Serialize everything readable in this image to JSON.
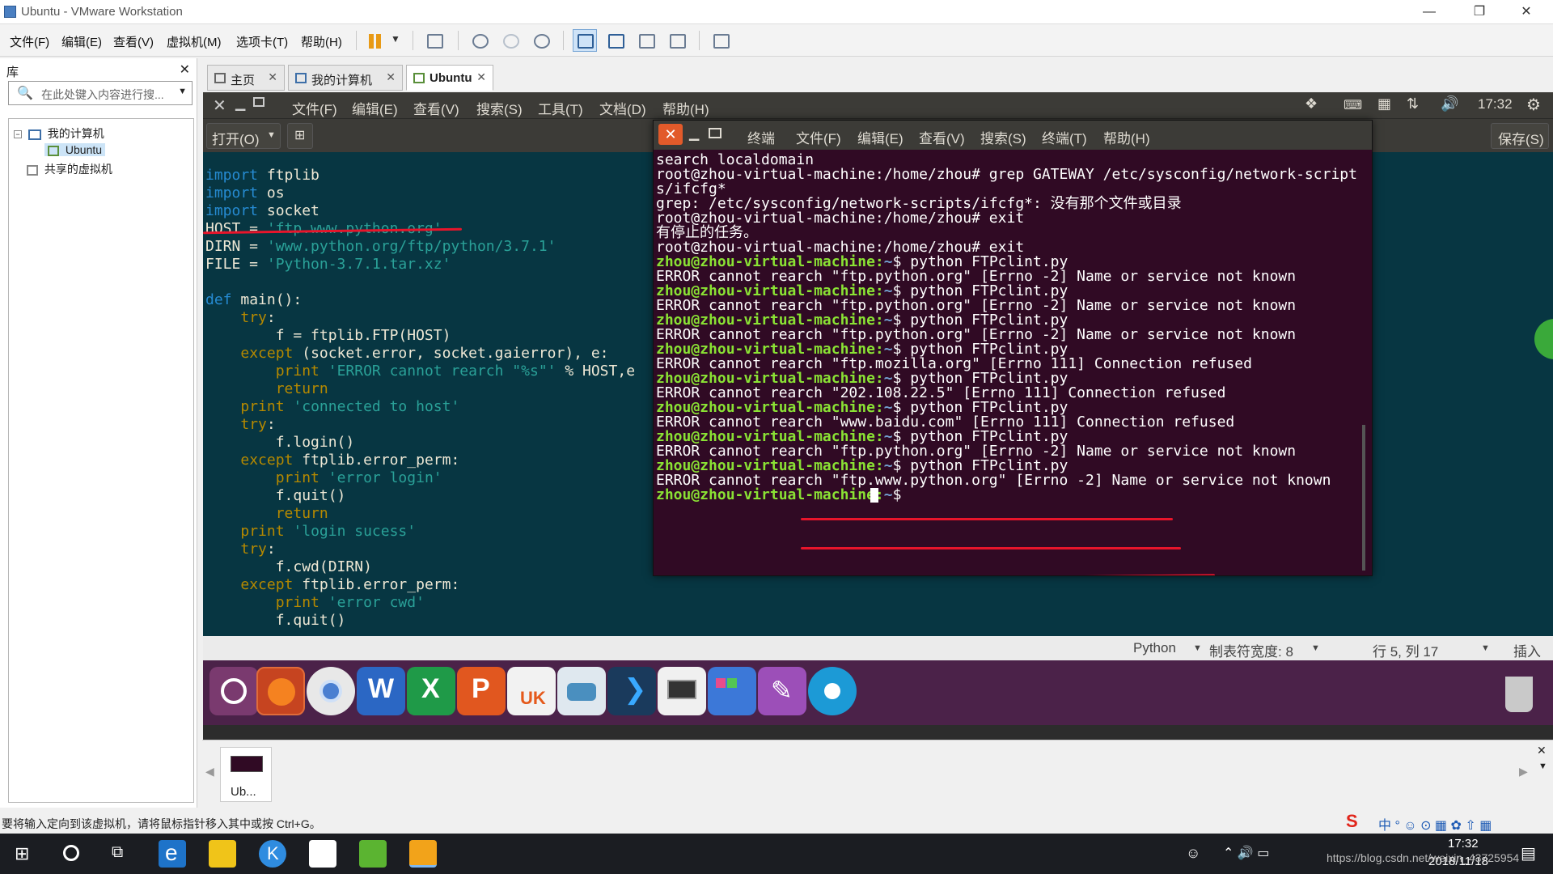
{
  "window": {
    "title": "Ubuntu - VMware Workstation"
  },
  "vm_menu": [
    "文件(F)",
    "编辑(E)",
    "查看(V)",
    "虚拟机(M)",
    "选项卡(T)",
    "帮助(H)"
  ],
  "library": {
    "title": "库",
    "search_placeholder": "在此处键入内容进行搜...",
    "tree": [
      "我的计算机",
      "Ubuntu",
      "共享的虚拟机"
    ]
  },
  "tabs": [
    {
      "label": "主页"
    },
    {
      "label": "我的计算机"
    },
    {
      "label": "Ubuntu"
    }
  ],
  "ubuntu_menu": [
    "文件(F)",
    "编辑(E)",
    "查看(V)",
    "搜索(S)",
    "工具(T)",
    "文档(D)",
    "帮助(H)"
  ],
  "ubuntu_clock": "17:32",
  "gedit": {
    "open_label": "打开(O)",
    "save_label": "保存(S)",
    "code": [
      "import ftplib",
      "import os",
      "import socket",
      "HOST = 'ftp.www.python.org'",
      "DIRN = 'www.python.org/ftp/python/3.7.1'",
      "FILE = 'Python-3.7.1.tar.xz'",
      "",
      "def main():",
      "    try:",
      "        f = ftplib.FTP(HOST)",
      "    except (socket.error, socket.gaierror), e:",
      "        print 'ERROR cannot rearch \"%s\"' % HOST,e",
      "        return",
      "    print 'connected to host'",
      "    try:",
      "        f.login()",
      "    except ftplib.error_perm:",
      "        print 'error login'",
      "        f.quit()",
      "        return",
      "    print 'login sucess'",
      "    try:",
      "        f.cwd(DIRN)",
      "    except ftplib.error_perm:",
      "        print 'error cwd'",
      "        f.quit()"
    ],
    "status": {
      "lang": "Python",
      "tab_width": "制表符宽度: 8",
      "position": "行 5, 列 17",
      "mode": "插入"
    }
  },
  "terminal": {
    "menu": [
      "终端",
      "文件(F)",
      "编辑(E)",
      "查看(V)",
      "搜索(S)",
      "终端(T)",
      "帮助(H)"
    ],
    "lines": [
      {
        "prompt": "",
        "text": "search localdomain"
      },
      {
        "prompt": "",
        "text": "root@zhou-virtual-machine:/home/zhou# grep GATEWAY /etc/sysconfig/network-script"
      },
      {
        "prompt": "",
        "text": "s/ifcfg*"
      },
      {
        "prompt": "",
        "text": "grep: /etc/sysconfig/network-scripts/ifcfg*: 没有那个文件或目录"
      },
      {
        "prompt": "",
        "text": "root@zhou-virtual-machine:/home/zhou# exit"
      },
      {
        "prompt": "",
        "text": "有停止的任务。"
      },
      {
        "prompt": "",
        "text": "root@zhou-virtual-machine:/home/zhou# exit"
      },
      {
        "prompt": "zhou@zhou-virtual-machine:",
        "text": "~$ python FTPclint.py"
      },
      {
        "prompt": "",
        "text": "ERROR cannot rearch \"ftp.python.org\" [Errno -2] Name or service not known"
      },
      {
        "prompt": "zhou@zhou-virtual-machine:",
        "text": "~$ python FTPclint.py"
      },
      {
        "prompt": "",
        "text": "ERROR cannot rearch \"ftp.python.org\" [Errno -2] Name or service not known"
      },
      {
        "prompt": "zhou@zhou-virtual-machine:",
        "text": "~$ python FTPclint.py"
      },
      {
        "prompt": "",
        "text": "ERROR cannot rearch \"ftp.python.org\" [Errno -2] Name or service not known"
      },
      {
        "prompt": "zhou@zhou-virtual-machine:",
        "text": "~$ python FTPclint.py"
      },
      {
        "prompt": "",
        "text": "ERROR cannot rearch \"ftp.mozilla.org\" [Errno 111] Connection refused"
      },
      {
        "prompt": "zhou@zhou-virtual-machine:",
        "text": "~$ python FTPclint.py"
      },
      {
        "prompt": "",
        "text": "ERROR cannot rearch \"202.108.22.5\" [Errno 111] Connection refused"
      },
      {
        "prompt": "zhou@zhou-virtual-machine:",
        "text": "~$ python FTPclint.py"
      },
      {
        "prompt": "",
        "text": "ERROR cannot rearch \"www.baidu.com\" [Errno 111] Connection refused"
      },
      {
        "prompt": "zhou@zhou-virtual-machine:",
        "text": "~$ python FTPclint.py"
      },
      {
        "prompt": "",
        "text": "ERROR cannot rearch \"ftp.python.org\" [Errno -2] Name or service not known"
      },
      {
        "prompt": "zhou@zhou-virtual-machine:",
        "text": "~$ python FTPclint.py"
      },
      {
        "prompt": "",
        "text": "ERROR cannot rearch \"ftp.www.python.org\" [Errno -2] Name or service not known"
      },
      {
        "prompt": "zhou@zhou-virtual-machine:",
        "text": "~$ "
      }
    ]
  },
  "thumb": {
    "label": "Ub..."
  },
  "vm_status": "要将输入定向到该虚拟机，请将鼠标指针移入其中或按 Ctrl+G。",
  "taskbar": {
    "time": "17:32",
    "date": "2018/11/18",
    "watermark": "https://blog.csdn.net/weixin_43725954"
  },
  "colors": {
    "terminal_bg": "#300a24",
    "editor_bg": "#073642",
    "dock_bg": "#4b2249",
    "annotation_red": "#e8152b"
  }
}
